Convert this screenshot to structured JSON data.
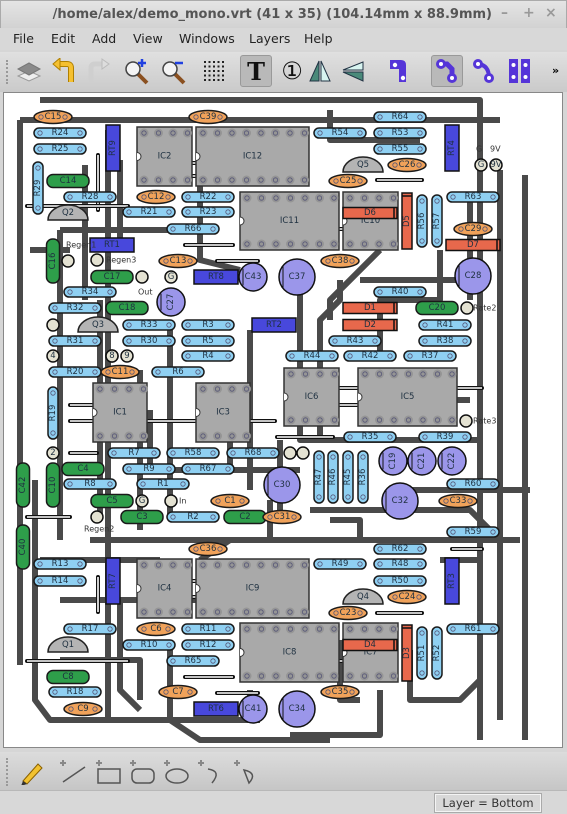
{
  "window": {
    "title": "/home/alex/demo_mono.vrt    (41 x 35)    (104.14mm x 88.9mm)",
    "minimize": "–",
    "maximize": "+",
    "close": "×"
  },
  "menu": [
    "File",
    "Edit",
    "Add",
    "View",
    "Windows",
    "Layers",
    "Help"
  ],
  "toolbar": {
    "icons": [
      "layers-icon",
      "undo-icon",
      "redo-icon",
      "zoom-in-icon",
      "zoom-out-icon",
      "grid-icon",
      "text-icon",
      "pin-number-icon",
      "mirror-vertical-icon",
      "mirror-horizontal-icon",
      "track-style-1-icon",
      "track-style-2-icon",
      "track-style-3-icon",
      "pad-style-icon"
    ],
    "pressed": [
      "text-icon",
      "track-style-2-icon"
    ],
    "overflow": "»",
    "text_glyph": "T",
    "pin_glyph": "①"
  },
  "draw_toolbar": {
    "icons": [
      "pencil-icon",
      "add-line-icon",
      "add-rectangle-icon",
      "add-rounded-rectangle-icon",
      "add-ellipse-icon",
      "add-arc-icon",
      "add-chord-icon"
    ]
  },
  "status": {
    "layer": "Layer = Bottom"
  },
  "colors": {
    "track": "#4a4a4a",
    "resistor": "#8fd0f2",
    "ceramic_cap": "#f0a25a",
    "film_cap": "#2e9e4a",
    "electrolytic": "#9b96ea",
    "trimmer": "#4848dc",
    "diode": "#e8684c",
    "ic": "#a9a9a9",
    "transistor": "#b4b4b4",
    "pad": "#e4e2d2"
  },
  "board": {
    "components": [
      {
        "label": "C15",
        "type": "ceramic"
      },
      {
        "label": "R24",
        "type": "resistor"
      },
      {
        "label": "R25",
        "type": "resistor"
      },
      {
        "label": "RT9",
        "type": "trimmer"
      },
      {
        "label": "R29",
        "type": "resistor"
      },
      {
        "label": "C14",
        "type": "film"
      },
      {
        "label": "R28",
        "type": "resistor"
      },
      {
        "label": "Q2",
        "type": "transistor"
      },
      {
        "label": "C39",
        "type": "ceramic"
      },
      {
        "label": "IC2",
        "type": "ic"
      },
      {
        "label": "IC12",
        "type": "ic"
      },
      {
        "label": "R54",
        "type": "resistor"
      },
      {
        "label": "R64",
        "type": "resistor"
      },
      {
        "label": "R53",
        "type": "resistor"
      },
      {
        "label": "R55",
        "type": "resistor"
      },
      {
        "label": "RT4",
        "type": "trimmer"
      },
      {
        "label": "Q5",
        "type": "transistor"
      },
      {
        "label": "C26",
        "type": "ceramic"
      },
      {
        "label": "C25",
        "type": "ceramic"
      },
      {
        "label": "C12",
        "type": "ceramic"
      },
      {
        "label": "R22",
        "type": "resistor"
      },
      {
        "label": "R21",
        "type": "resistor"
      },
      {
        "label": "R23",
        "type": "resistor"
      },
      {
        "label": "R66",
        "type": "resistor"
      },
      {
        "label": "IC11",
        "type": "ic"
      },
      {
        "label": "IC10",
        "type": "ic"
      },
      {
        "label": "D6",
        "type": "diode"
      },
      {
        "label": "D5",
        "type": "diode"
      },
      {
        "label": "R56",
        "type": "resistor"
      },
      {
        "label": "R57",
        "type": "resistor"
      },
      {
        "label": "R63",
        "type": "resistor"
      },
      {
        "label": "C29",
        "type": "ceramic"
      },
      {
        "label": "D7",
        "type": "diode"
      },
      {
        "label": "C28",
        "type": "electrolytic"
      },
      {
        "label": "RT1",
        "type": "trimmer"
      },
      {
        "label": "C16",
        "type": "film"
      },
      {
        "label": "C17",
        "type": "film"
      },
      {
        "label": "C27",
        "type": "electrolytic"
      },
      {
        "label": "RT8",
        "type": "trimmer"
      },
      {
        "label": "C43",
        "type": "electrolytic"
      },
      {
        "label": "C37",
        "type": "electrolytic"
      },
      {
        "label": "C13",
        "type": "ceramic"
      },
      {
        "label": "C38",
        "type": "ceramic"
      },
      {
        "label": "R34",
        "type": "resistor"
      },
      {
        "label": "R32",
        "type": "resistor"
      },
      {
        "label": "C18",
        "type": "film"
      },
      {
        "label": "R40",
        "type": "resistor"
      },
      {
        "label": "D1",
        "type": "diode"
      },
      {
        "label": "C20",
        "type": "film"
      },
      {
        "label": "Q3",
        "type": "transistor"
      },
      {
        "label": "R33",
        "type": "resistor"
      },
      {
        "label": "R3",
        "type": "resistor"
      },
      {
        "label": "RT2",
        "type": "trimmer"
      },
      {
        "label": "D2",
        "type": "diode"
      },
      {
        "label": "R41",
        "type": "resistor"
      },
      {
        "label": "R31",
        "type": "resistor"
      },
      {
        "label": "R30",
        "type": "resistor"
      },
      {
        "label": "R5",
        "type": "resistor"
      },
      {
        "label": "R43",
        "type": "resistor"
      },
      {
        "label": "R38",
        "type": "resistor"
      },
      {
        "label": "R4",
        "type": "resistor"
      },
      {
        "label": "R44",
        "type": "resistor"
      },
      {
        "label": "R42",
        "type": "resistor"
      },
      {
        "label": "R37",
        "type": "resistor"
      },
      {
        "label": "R20",
        "type": "resistor"
      },
      {
        "label": "C11",
        "type": "ceramic"
      },
      {
        "label": "R6",
        "type": "resistor"
      },
      {
        "label": "IC1",
        "type": "ic"
      },
      {
        "label": "IC3",
        "type": "ic"
      },
      {
        "label": "IC6",
        "type": "ic"
      },
      {
        "label": "IC5",
        "type": "ic"
      },
      {
        "label": "R19",
        "type": "resistor"
      },
      {
        "label": "R35",
        "type": "resistor"
      },
      {
        "label": "R39",
        "type": "resistor"
      },
      {
        "label": "R7",
        "type": "resistor"
      },
      {
        "label": "R58",
        "type": "resistor"
      },
      {
        "label": "R68",
        "type": "resistor"
      },
      {
        "label": "R47",
        "type": "resistor"
      },
      {
        "label": "R46",
        "type": "resistor"
      },
      {
        "label": "R45",
        "type": "resistor"
      },
      {
        "label": "R36",
        "type": "resistor"
      },
      {
        "label": "C19",
        "type": "electrolytic"
      },
      {
        "label": "C21",
        "type": "electrolytic"
      },
      {
        "label": "C22",
        "type": "electrolytic"
      },
      {
        "label": "C42",
        "type": "film"
      },
      {
        "label": "C10",
        "type": "film"
      },
      {
        "label": "C4",
        "type": "film"
      },
      {
        "label": "R9",
        "type": "resistor"
      },
      {
        "label": "R67",
        "type": "resistor"
      },
      {
        "label": "C30",
        "type": "electrolytic"
      },
      {
        "label": "R8",
        "type": "resistor"
      },
      {
        "label": "R1",
        "type": "resistor"
      },
      {
        "label": "R60",
        "type": "resistor"
      },
      {
        "label": "C32",
        "type": "electrolytic"
      },
      {
        "label": "C5",
        "type": "film"
      },
      {
        "label": "C1",
        "type": "ceramic"
      },
      {
        "label": "C33",
        "type": "ceramic"
      },
      {
        "label": "C3",
        "type": "film"
      },
      {
        "label": "R2",
        "type": "resistor"
      },
      {
        "label": "C2",
        "type": "film"
      },
      {
        "label": "C31",
        "type": "ceramic"
      },
      {
        "label": "R59",
        "type": "resistor"
      },
      {
        "label": "C40",
        "type": "film"
      },
      {
        "label": "C36",
        "type": "ceramic"
      },
      {
        "label": "R62",
        "type": "resistor"
      },
      {
        "label": "R13",
        "type": "resistor"
      },
      {
        "label": "R14",
        "type": "resistor"
      },
      {
        "label": "RT7",
        "type": "trimmer"
      },
      {
        "label": "IC4",
        "type": "ic"
      },
      {
        "label": "IC9",
        "type": "ic"
      },
      {
        "label": "R49",
        "type": "resistor"
      },
      {
        "label": "R48",
        "type": "resistor"
      },
      {
        "label": "R50",
        "type": "resistor"
      },
      {
        "label": "RT3",
        "type": "trimmer"
      },
      {
        "label": "Q4",
        "type": "transistor"
      },
      {
        "label": "C24",
        "type": "ceramic"
      },
      {
        "label": "C23",
        "type": "ceramic"
      },
      {
        "label": "R17",
        "type": "resistor"
      },
      {
        "label": "C6",
        "type": "ceramic"
      },
      {
        "label": "R11",
        "type": "resistor"
      },
      {
        "label": "R61",
        "type": "resistor"
      },
      {
        "label": "IC8",
        "type": "ic"
      },
      {
        "label": "IC7",
        "type": "ic"
      },
      {
        "label": "D4",
        "type": "diode"
      },
      {
        "label": "D3",
        "type": "diode"
      },
      {
        "label": "R51",
        "type": "resistor"
      },
      {
        "label": "R52",
        "type": "resistor"
      },
      {
        "label": "Q1",
        "type": "transistor"
      },
      {
        "label": "R10",
        "type": "resistor"
      },
      {
        "label": "R12",
        "type": "resistor"
      },
      {
        "label": "R65",
        "type": "resistor"
      },
      {
        "label": "C8",
        "type": "film"
      },
      {
        "label": "R18",
        "type": "resistor"
      },
      {
        "label": "C7",
        "type": "ceramic"
      },
      {
        "label": "C35",
        "type": "ceramic"
      },
      {
        "label": "C9",
        "type": "ceramic"
      },
      {
        "label": "RT6",
        "type": "trimmer"
      },
      {
        "label": "C41",
        "type": "electrolytic"
      },
      {
        "label": "C34",
        "type": "electrolytic"
      }
    ],
    "pads": [
      "G",
      "9V",
      "",
      "",
      "G",
      "",
      "",
      "",
      "4",
      "",
      "8",
      "9",
      "",
      "2",
      "G",
      "",
      "",
      "",
      "",
      "",
      "",
      ""
    ],
    "texts": [
      "G",
      "9V",
      "Regen1",
      "Regen3",
      "Out",
      "Rate2",
      "Rate3",
      "In",
      "Regen2"
    ]
  }
}
